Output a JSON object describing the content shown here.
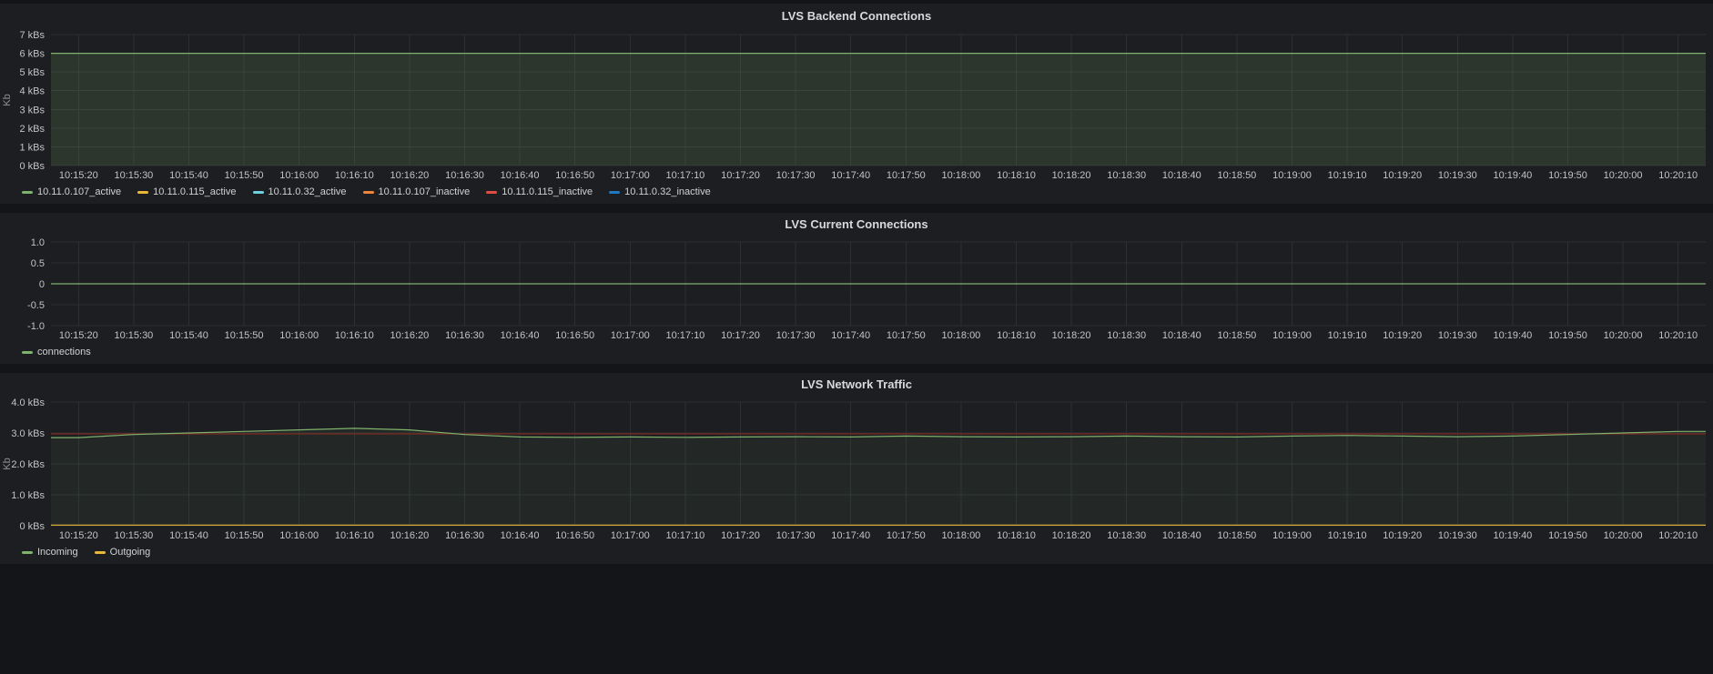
{
  "theme": {
    "page_bg": "#141518",
    "panel_bg": "#1d1e21",
    "grid_color": "#2c2e31",
    "tick_color": "#c2c3c5",
    "title_color": "#d8d9da",
    "legend_text_color": "#d0d1d3",
    "axis_label_color": "#8e9094",
    "series_green": "#7EB26D",
    "series_yellow": "#EAB839",
    "series_cyan": "#6ED0E0",
    "series_orange": "#EF843C",
    "series_red": "#E24D42",
    "series_blue": "#1F78C1"
  },
  "chart_data": [
    {
      "type": "line",
      "title": "LVS Backend Connections",
      "ylabel": "Kb",
      "ylim": [
        0,
        7
      ],
      "grid": true,
      "legend_position": "bottom-left",
      "y_ticks": [
        {
          "value": 7,
          "label": "7 kBs"
        },
        {
          "value": 6,
          "label": "6 kBs"
        },
        {
          "value": 5,
          "label": "5 kBs"
        },
        {
          "value": 4,
          "label": "4 kBs"
        },
        {
          "value": 3,
          "label": "3 kBs"
        },
        {
          "value": 2,
          "label": "2 kBs"
        },
        {
          "value": 1,
          "label": "1 kBs"
        },
        {
          "value": 0,
          "label": "0 kBs"
        }
      ],
      "x_ticks": [
        "10:15:20",
        "10:15:30",
        "10:15:40",
        "10:15:50",
        "10:16:00",
        "10:16:10",
        "10:16:20",
        "10:16:30",
        "10:16:40",
        "10:16:50",
        "10:17:00",
        "10:17:10",
        "10:17:20",
        "10:17:30",
        "10:17:40",
        "10:17:50",
        "10:18:00",
        "10:18:10",
        "10:18:20",
        "10:18:30",
        "10:18:40",
        "10:18:50",
        "10:19:00",
        "10:19:10",
        "10:19:20",
        "10:19:30",
        "10:19:40",
        "10:19:50",
        "10:20:00",
        "10:20:10"
      ],
      "series": [
        {
          "name": "10.11.0.107_active",
          "color": "#7EB26D",
          "fill": true,
          "fill_opacity": 0.16,
          "values": [
            6,
            6,
            6,
            6,
            6,
            6,
            6,
            6,
            6,
            6,
            6,
            6,
            6,
            6,
            6,
            6,
            6,
            6,
            6,
            6,
            6,
            6,
            6,
            6,
            6,
            6,
            6,
            6,
            6,
            6
          ]
        },
        {
          "name": "10.11.0.115_active",
          "color": "#EAB839",
          "values": []
        },
        {
          "name": "10.11.0.32_active",
          "color": "#6ED0E0",
          "values": []
        },
        {
          "name": "10.11.0.107_inactive",
          "color": "#EF843C",
          "values": []
        },
        {
          "name": "10.11.0.115_inactive",
          "color": "#E24D42",
          "values": []
        },
        {
          "name": "10.11.0.32_inactive",
          "color": "#1F78C1",
          "values": []
        }
      ]
    },
    {
      "type": "line",
      "title": "LVS Current Connections",
      "ylabel": "",
      "ylim": [
        -1,
        1
      ],
      "grid": true,
      "legend_position": "bottom-left",
      "y_ticks": [
        {
          "value": 1.0,
          "label": "1.0"
        },
        {
          "value": 0.5,
          "label": "0.5"
        },
        {
          "value": 0,
          "label": "0"
        },
        {
          "value": -0.5,
          "label": "-0.5"
        },
        {
          "value": -1.0,
          "label": "-1.0"
        }
      ],
      "x_ticks": [
        "10:15:20",
        "10:15:30",
        "10:15:40",
        "10:15:50",
        "10:16:00",
        "10:16:10",
        "10:16:20",
        "10:16:30",
        "10:16:40",
        "10:16:50",
        "10:17:00",
        "10:17:10",
        "10:17:20",
        "10:17:30",
        "10:17:40",
        "10:17:50",
        "10:18:00",
        "10:18:10",
        "10:18:20",
        "10:18:30",
        "10:18:40",
        "10:18:50",
        "10:19:00",
        "10:19:10",
        "10:19:20",
        "10:19:30",
        "10:19:40",
        "10:19:50",
        "10:20:00",
        "10:20:10"
      ],
      "series": [
        {
          "name": "connections",
          "color": "#7EB26D",
          "values": [
            0,
            0,
            0,
            0,
            0,
            0,
            0,
            0,
            0,
            0,
            0,
            0,
            0,
            0,
            0,
            0,
            0,
            0,
            0,
            0,
            0,
            0,
            0,
            0,
            0,
            0,
            0,
            0,
            0,
            0
          ]
        }
      ]
    },
    {
      "type": "line",
      "title": "LVS Network Traffic",
      "ylabel": "Kb",
      "ylim": [
        0,
        4
      ],
      "grid": true,
      "legend_position": "bottom-left",
      "threshold": {
        "value": 2.97,
        "color": "#7e2a20"
      },
      "y_ticks": [
        {
          "value": 4.0,
          "label": "4.0 kBs"
        },
        {
          "value": 3.0,
          "label": "3.0 kBs"
        },
        {
          "value": 2.0,
          "label": "2.0 kBs"
        },
        {
          "value": 1.0,
          "label": "1.0 kBs"
        },
        {
          "value": 0,
          "label": "0 kBs"
        }
      ],
      "x_ticks": [
        "10:15:20",
        "10:15:30",
        "10:15:40",
        "10:15:50",
        "10:16:00",
        "10:16:10",
        "10:16:20",
        "10:16:30",
        "10:16:40",
        "10:16:50",
        "10:17:00",
        "10:17:10",
        "10:17:20",
        "10:17:30",
        "10:17:40",
        "10:17:50",
        "10:18:00",
        "10:18:10",
        "10:18:20",
        "10:18:30",
        "10:18:40",
        "10:18:50",
        "10:19:00",
        "10:19:10",
        "10:19:20",
        "10:19:30",
        "10:19:40",
        "10:19:50",
        "10:20:00",
        "10:20:10"
      ],
      "series": [
        {
          "name": "Incoming",
          "color": "#7EB26D",
          "fill": true,
          "fill_opacity": 0.07,
          "values": [
            2.85,
            2.95,
            3.0,
            3.05,
            3.1,
            3.15,
            3.1,
            2.95,
            2.87,
            2.86,
            2.87,
            2.86,
            2.87,
            2.88,
            2.87,
            2.9,
            2.88,
            2.87,
            2.88,
            2.9,
            2.88,
            2.87,
            2.9,
            2.92,
            2.9,
            2.88,
            2.9,
            2.95,
            3.0,
            3.05
          ]
        },
        {
          "name": "Outgoing",
          "color": "#EAB839",
          "values": [
            0.02,
            0.02,
            0.02,
            0.02,
            0.02,
            0.02,
            0.02,
            0.02,
            0.02,
            0.02,
            0.02,
            0.02,
            0.02,
            0.02,
            0.02,
            0.02,
            0.02,
            0.02,
            0.02,
            0.02,
            0.02,
            0.02,
            0.02,
            0.02,
            0.02,
            0.02,
            0.02,
            0.02,
            0.02,
            0.02
          ]
        }
      ]
    }
  ]
}
